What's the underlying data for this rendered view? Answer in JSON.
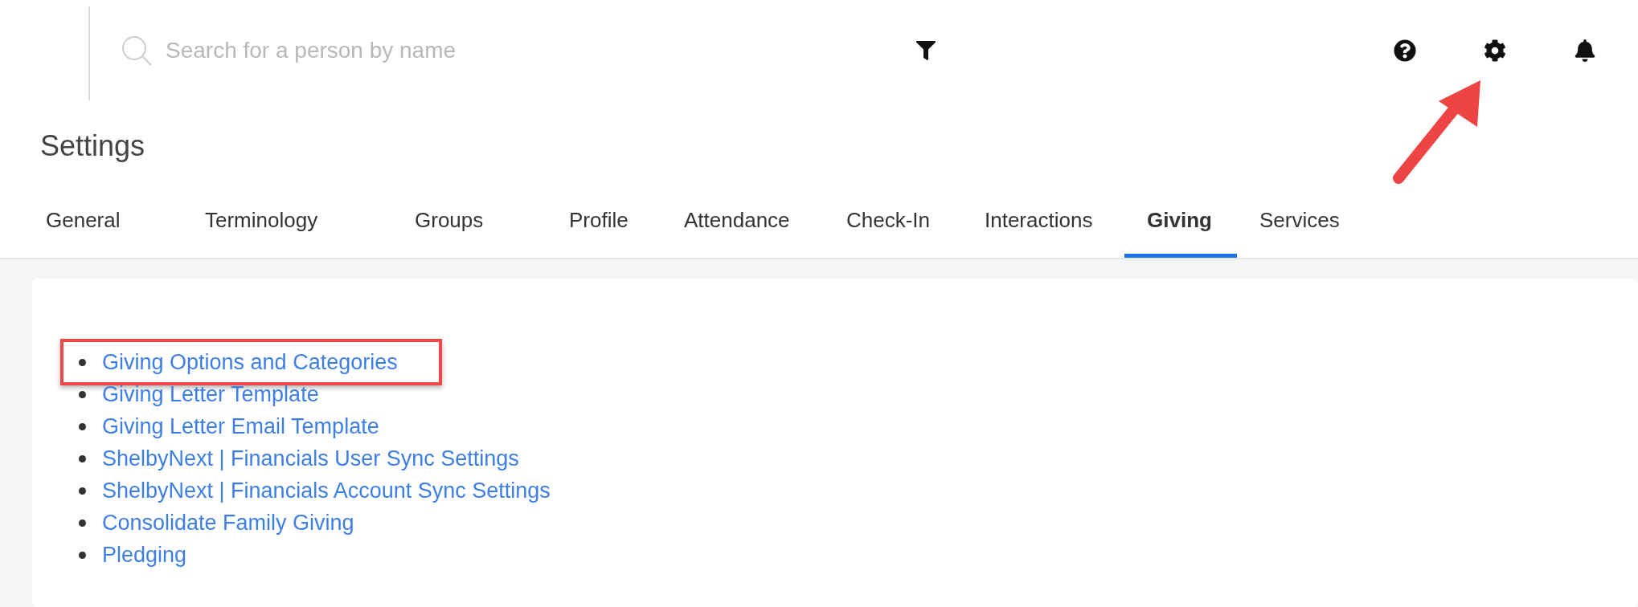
{
  "search": {
    "placeholder": "Search for a person by name"
  },
  "page_title": "Settings",
  "tabs": [
    {
      "label": "General",
      "selected": false
    },
    {
      "label": "Terminology",
      "selected": false
    },
    {
      "label": "Groups",
      "selected": false
    },
    {
      "label": "Profile",
      "selected": false
    },
    {
      "label": "Attendance",
      "selected": false
    },
    {
      "label": "Check-In",
      "selected": false
    },
    {
      "label": "Interactions",
      "selected": false
    },
    {
      "label": "Giving",
      "selected": true
    },
    {
      "label": "Services",
      "selected": false
    }
  ],
  "links": [
    {
      "label": "Giving Options and Categories",
      "highlighted": true
    },
    {
      "label": "Giving Letter Template",
      "highlighted": false
    },
    {
      "label": "Giving Letter Email Template",
      "highlighted": false
    },
    {
      "label": "ShelbyNext | Financials User Sync Settings",
      "highlighted": false
    },
    {
      "label": "ShelbyNext | Financials Account Sync Settings",
      "highlighted": false
    },
    {
      "label": "Consolidate Family Giving",
      "highlighted": false
    },
    {
      "label": "Pledging",
      "highlighted": false
    }
  ]
}
